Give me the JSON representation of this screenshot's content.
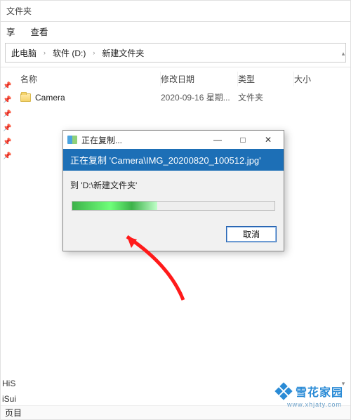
{
  "window": {
    "title": "文件夹"
  },
  "menubar": {
    "items": [
      "享",
      "查看"
    ]
  },
  "breadcrumb": {
    "c1": "此电脑",
    "c2": "软件 (D:)",
    "c3": "新建文件夹"
  },
  "columns": {
    "name": "名称",
    "date": "修改日期",
    "type": "类型",
    "size": "大小"
  },
  "rows": [
    {
      "name": "Camera",
      "date": "2020-09-16 星期...",
      "type": "文件夹",
      "size": ""
    }
  ],
  "sidebar_bottom": {
    "a": "HiS",
    "b": "iSui"
  },
  "status": {
    "text": "页目"
  },
  "dialog": {
    "title": "正在复制...",
    "banner_prefix": "正在复制 '",
    "banner_file": "Camera\\IMG_20200820_100512.jpg",
    "banner_suffix": "'",
    "dest_prefix": "到 '",
    "dest_path": "D:\\新建文件夹",
    "dest_suffix": "'",
    "cancel": "取消",
    "minimize": "—",
    "maximize": "□",
    "close": "✕"
  },
  "branding": {
    "text": "雪花家园",
    "url": "www.xhjaty.com"
  }
}
